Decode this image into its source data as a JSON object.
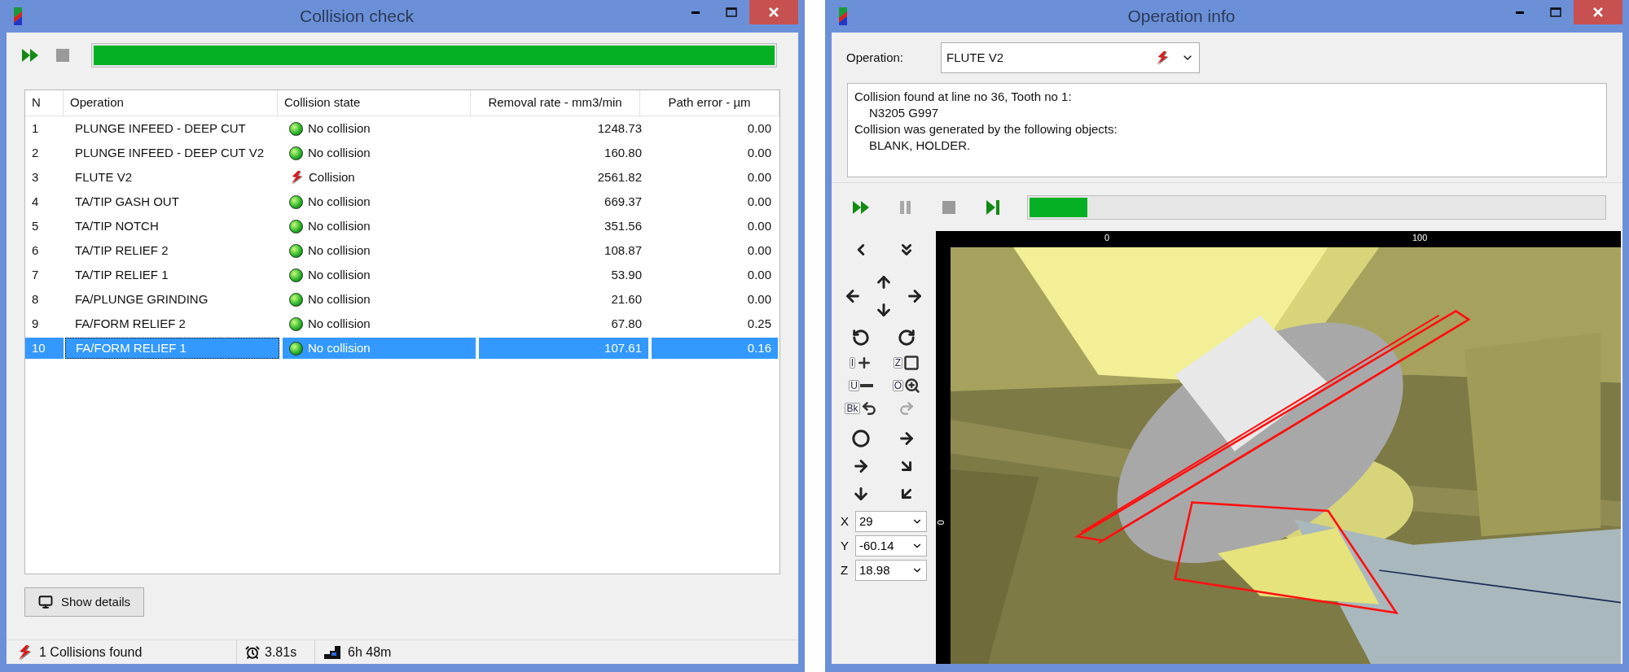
{
  "collision_window": {
    "title": "Collision check",
    "toolbar": {
      "stop_disabled": true
    },
    "progress": {
      "level": 1.0
    },
    "table": {
      "columns": [
        "N",
        "Operation",
        "Collision state",
        "Removal rate - mm3/min",
        "Path error - µm"
      ],
      "rows": [
        {
          "n": "1",
          "operation": "PLUNGE INFEED - DEEP CUT",
          "state": {
            "kind": "ok",
            "text": "No collision"
          },
          "removal_rate": "1248.73",
          "path_error": "0.00",
          "selected": false
        },
        {
          "n": "2",
          "operation": "PLUNGE INFEED - DEEP CUT V2",
          "state": {
            "kind": "ok",
            "text": "No collision"
          },
          "removal_rate": "160.80",
          "path_error": "0.00",
          "selected": false
        },
        {
          "n": "3",
          "operation": "FLUTE V2",
          "state": {
            "kind": "collision",
            "text": "Collision"
          },
          "removal_rate": "2561.82",
          "path_error": "0.00",
          "selected": false
        },
        {
          "n": "4",
          "operation": "TA/TIP GASH OUT",
          "state": {
            "kind": "ok",
            "text": "No collision"
          },
          "removal_rate": "669.37",
          "path_error": "0.00",
          "selected": false
        },
        {
          "n": "5",
          "operation": "TA/TIP NOTCH",
          "state": {
            "kind": "ok",
            "text": "No collision"
          },
          "removal_rate": "351.56",
          "path_error": "0.00",
          "selected": false
        },
        {
          "n": "6",
          "operation": "TA/TIP RELIEF 2",
          "state": {
            "kind": "ok",
            "text": "No collision"
          },
          "removal_rate": "108.87",
          "path_error": "0.00",
          "selected": false
        },
        {
          "n": "7",
          "operation": "TA/TIP RELIEF 1",
          "state": {
            "kind": "ok",
            "text": "No collision"
          },
          "removal_rate": "53.90",
          "path_error": "0.00",
          "selected": false
        },
        {
          "n": "8",
          "operation": "FA/PLUNGE GRINDING",
          "state": {
            "kind": "ok",
            "text": "No collision"
          },
          "removal_rate": "21.60",
          "path_error": "0.00",
          "selected": false
        },
        {
          "n": "9",
          "operation": "FA/FORM RELIEF 2",
          "state": {
            "kind": "ok",
            "text": "No collision"
          },
          "removal_rate": "67.80",
          "path_error": "0.25",
          "selected": false
        },
        {
          "n": "10",
          "operation": "FA/FORM RELIEF 1",
          "state": {
            "kind": "ok",
            "text": "No collision"
          },
          "removal_rate": "107.61",
          "path_error": "0.16",
          "selected": true
        }
      ]
    },
    "show_details_button": "Show details",
    "status_bar": {
      "collisions": "1 Collisions found",
      "time": "3.81s",
      "duration": "6h 48m"
    }
  },
  "operation_window": {
    "title": "Operation info",
    "operation_label": "Operation:",
    "operation_value": "FLUTE V2",
    "operation_state": {
      "kind": "collision"
    },
    "message": [
      {
        "text": "Collision found at line no 36, Tooth no 1:",
        "indent": false
      },
      {
        "text": "N3205 G997",
        "indent": true
      },
      {
        "text": "Collision was generated by the following objects:",
        "indent": false
      },
      {
        "text": "BLANK, HOLDER.",
        "indent": true
      }
    ],
    "toolbar": {
      "pause_disabled": true,
      "stop_disabled": true
    },
    "progress": {
      "level": 0.1
    },
    "view_tools": [
      {
        "kind": "zoom_in",
        "key": "I",
        "disabled": false
      },
      {
        "kind": "zoom_window",
        "key": "Z",
        "disabled": false
      },
      {
        "kind": "zoom_out",
        "key": "U",
        "disabled": false
      },
      {
        "kind": "zoom_fit",
        "key": "O",
        "disabled": false
      },
      {
        "kind": "undo",
        "key": "Bk",
        "disabled": false
      },
      {
        "kind": "redo",
        "disabled": true
      }
    ],
    "coordinates": [
      {
        "label": "X",
        "value": "29"
      },
      {
        "label": "Y",
        "value": "-60.14"
      },
      {
        "label": "Z",
        "value": "18.98"
      }
    ],
    "ruler": {
      "top_labels": [
        "0",
        "100"
      ],
      "left_labels": [
        "0"
      ]
    }
  }
}
